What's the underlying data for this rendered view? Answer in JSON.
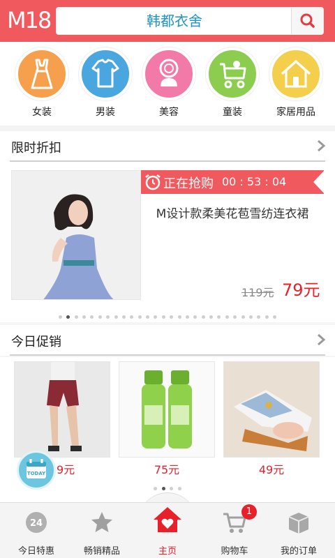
{
  "header": {
    "logo": "M18",
    "search_value": "韩都衣舍"
  },
  "categories": [
    {
      "label": "女装",
      "icon": "dress-icon",
      "color": "#f6a04d"
    },
    {
      "label": "男装",
      "icon": "tshirt-icon",
      "color": "#4aa6df"
    },
    {
      "label": "美容",
      "icon": "mirror-icon",
      "color": "#f27aa8"
    },
    {
      "label": "童装",
      "icon": "stroller-icon",
      "color": "#8ccc4f"
    },
    {
      "label": "家居用品",
      "icon": "house-icon",
      "color": "#f3cf4b"
    }
  ],
  "flash_sale": {
    "title": "限时折扣",
    "status": "正在抢购",
    "timer": "00 : 53 : 04",
    "product_name": "M设计款柔美花苞雪纺连衣裙",
    "old_price": "119元",
    "new_price": "79元"
  },
  "promo": {
    "title": "今日促销",
    "items": [
      {
        "price": "19元"
      },
      {
        "price": "75元"
      },
      {
        "price": "49元"
      }
    ],
    "today_badge": "TODAY"
  },
  "bottom_nav": [
    {
      "label": "今日特惠",
      "icon": "calendar-24-icon"
    },
    {
      "label": "畅销精品",
      "icon": "star-icon"
    },
    {
      "label": "主页",
      "icon": "home-heart-icon"
    },
    {
      "label": "购物车",
      "icon": "cart-icon",
      "badge": "1"
    },
    {
      "label": "我的订单",
      "icon": "box-icon"
    }
  ]
}
